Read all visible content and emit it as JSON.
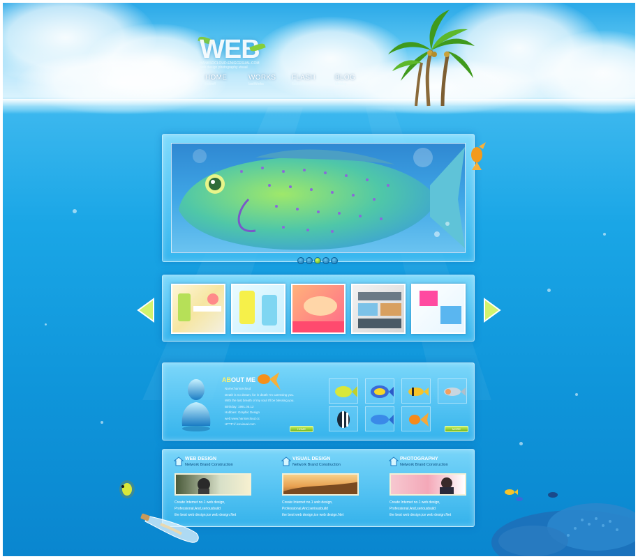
{
  "brand": {
    "logo_text": "WEB",
    "logo_sub_1": "HANKSOCLOUD-ENIGCESUAL.COM",
    "logo_sub_2": "web design photography visual"
  },
  "nav": [
    {
      "label": "HOME",
      "sub": "Indexff"
    },
    {
      "label": "WORKS",
      "sub": "lastWorks"
    },
    {
      "label": "FLASH",
      "sub": "flashWorks"
    },
    {
      "label": "BLOG",
      "sub": "Meblog"
    }
  ],
  "slider": {
    "dots": 5,
    "active_dot": 3
  },
  "about": {
    "title_a": "AB",
    "title_b": "OUT ME",
    "lines": [
      "Name:hanicecloud",
      "Death is no dream, for in death I'm caressing you.",
      "With the last breath of my soul I'll be blessing you.",
      "Birthday: 1991.05.12",
      "Hobbies: Graphic Design",
      "web:www.hanicecloud.cc",
      "HTTP://.icevisual.com"
    ],
    "home_button": "HOME",
    "more_button": "MORE"
  },
  "columns": [
    {
      "title": "WEB DESIGN",
      "tags": "Network  Brand  Construction",
      "lines": [
        "Create Internet no.1 web design,",
        "Professional,And,seriousbuild",
        "the best web design,ice web design.Net"
      ]
    },
    {
      "title": "VISUAL DESIGN",
      "tags": "Network  Brand  Construction",
      "lines": [
        "Create Internet no.1 web design,",
        "Professional,And,seriousbuild",
        "the best web design,ice web design.Net"
      ]
    },
    {
      "title": "PHOTOGRAPHY",
      "tags": "Network  Brand  Construction",
      "lines": [
        "Create Internet no.1 web design,",
        "Professional,And,seriousbuild",
        "the best web design,ice web design.Net"
      ]
    }
  ],
  "colors": {
    "accent_green": "#8fd33d",
    "water": "#1aa6e6",
    "highlight": "#fff36a"
  }
}
